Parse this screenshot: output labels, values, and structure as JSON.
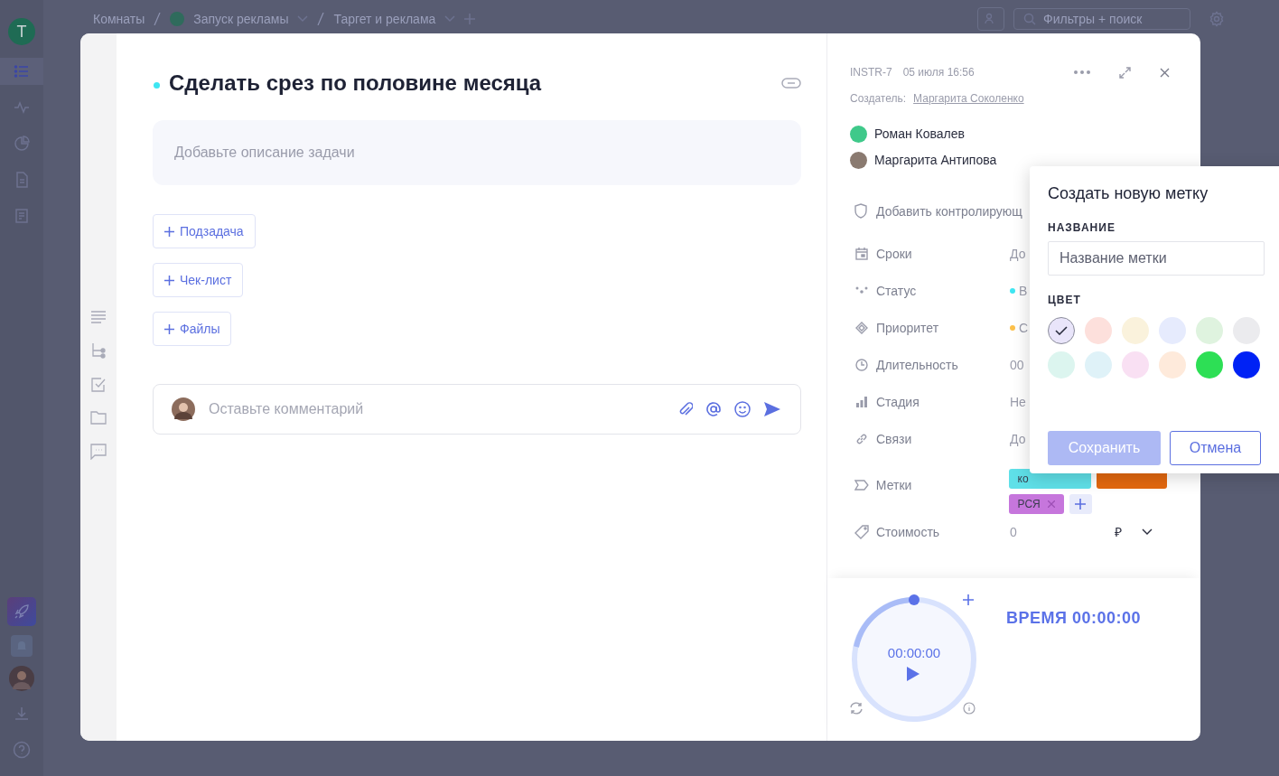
{
  "app_sidebar": {
    "workspace_initial": "T",
    "nav_items": [
      {
        "selected": true
      },
      {
        "selected": false
      },
      {
        "selected": false
      },
      {
        "selected": false
      },
      {
        "selected": false
      }
    ]
  },
  "top_bar": {
    "breadcrumbs": [
      "Комнаты",
      "Запуск рекламы",
      "Таргет и реклама"
    ],
    "search": {
      "placeholder": "Фильтры + поиск"
    }
  },
  "task": {
    "title": "Сделать срез по половине месяца",
    "description_placeholder": "Добавьте описание задачи",
    "add_buttons": [
      "Подзадача",
      "Чек-лист",
      "Файлы"
    ],
    "comment": {
      "placeholder": "Оставьте комментарий"
    }
  },
  "details": {
    "id": "INSTR-7",
    "date": "05 июля 16:56",
    "creator_label": "Создатель:",
    "creator": "Маргарита Соколенко",
    "assignees": [
      {
        "name": "Роман Ковалев",
        "color": "#3fc98a"
      },
      {
        "name": "Маргарита Антипова",
        "color": "#8a7a70"
      }
    ],
    "add_controller": "Добавить контролирующ",
    "fields": [
      {
        "label": "Сроки",
        "value": "До"
      },
      {
        "label": "Статус",
        "value": "В",
        "color": "#3ee6f2"
      },
      {
        "label": "Приоритет",
        "value": "С",
        "color": "#fcc04a"
      },
      {
        "label": "Длительность",
        "value": "00"
      },
      {
        "label": "Стадия",
        "value": "Не"
      },
      {
        "label": "Связи",
        "value": "До"
      }
    ],
    "tags_label": "Метки",
    "tags": [
      {
        "label": "ко",
        "color": "#5fe0e8"
      },
      {
        "color": "#e3680f"
      },
      {
        "label": "РСЯ",
        "color": "#c676dc",
        "removable": true
      }
    ],
    "cost": {
      "label": "Стоимость",
      "value": "0",
      "currency": "₽"
    }
  },
  "timer": {
    "display": "00:00:00",
    "total": "ВРЕМЯ 00:00:00"
  },
  "label_popover": {
    "title": "Создать новую метку",
    "name_label": "НАЗВАНИЕ",
    "name_placeholder": "Название метки",
    "color_label": "ЦВЕТ",
    "colors": [
      {
        "color": "#e9e5fa",
        "selected": true
      },
      {
        "color": "#fde0dc",
        "selected": false
      },
      {
        "color": "#faf2dc",
        "selected": false
      },
      {
        "color": "#e6ebfd",
        "selected": false
      },
      {
        "color": "#dff3df",
        "selected": false
      },
      {
        "color": "#ebebee",
        "selected": false
      },
      {
        "color": "#dcf5ef",
        "selected": false
      },
      {
        "color": "#dff2f8",
        "selected": false
      },
      {
        "color": "#f9e0f3",
        "selected": false
      },
      {
        "color": "#feeadb",
        "selected": false
      },
      {
        "color": "#2ddf55",
        "selected": false
      },
      {
        "color": "#0022f5",
        "selected": false
      }
    ],
    "save": {
      "label": "Сохранить",
      "disabled": true
    },
    "cancel": "Отмена"
  }
}
